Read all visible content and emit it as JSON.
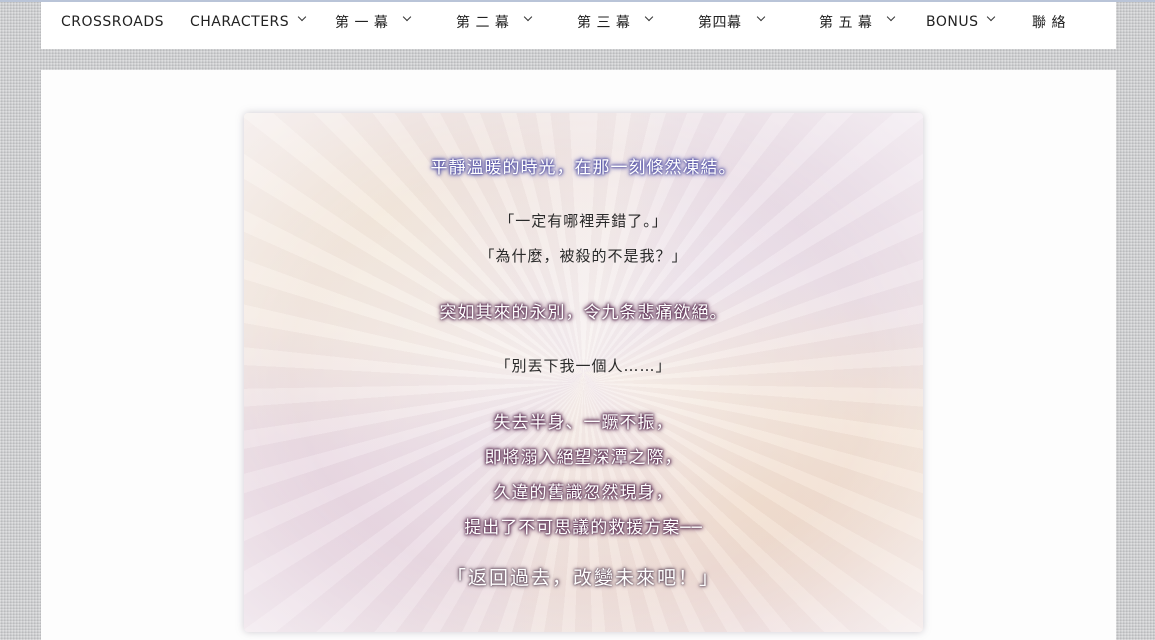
{
  "nav": {
    "items": [
      {
        "label": "CROSSROADS",
        "has_dropdown": false
      },
      {
        "label": "CHARACTERS",
        "has_dropdown": true
      },
      {
        "label": "第 一 幕",
        "has_dropdown": true
      },
      {
        "label": "第 二 幕",
        "has_dropdown": true
      },
      {
        "label": "第 三 幕",
        "has_dropdown": true
      },
      {
        "label": "第四幕",
        "has_dropdown": true
      },
      {
        "label": "第 五 幕",
        "has_dropdown": true
      },
      {
        "label": "BONUS",
        "has_dropdown": true
      },
      {
        "label": "聯 絡",
        "has_dropdown": false
      }
    ]
  },
  "story": {
    "lines": [
      {
        "text": "平靜溫暖的時光，在那一刻倏然凍結。",
        "style": "glow-blue"
      },
      {
        "text": "「一定有哪裡弄錯了。」",
        "style": "quote"
      },
      {
        "text": "「為什麼，被殺的不是我？」",
        "style": "quote"
      },
      {
        "text": "突如其來的永別，令九条悲痛欲絕。",
        "style": "glow-purple"
      },
      {
        "text": "「別丟下我一個人……」",
        "style": "quote"
      },
      {
        "text": "失去半身、一蹶不振，",
        "style": "glow-purple"
      },
      {
        "text": "即將溺入絕望深潭之際，",
        "style": "glow-purple"
      },
      {
        "text": "久違的舊識忽然現身，",
        "style": "glow-purple"
      },
      {
        "text": "提出了不可思議的救援方案──",
        "style": "glow-purple"
      },
      {
        "text": "「返回過去，改變未來吧！」",
        "style": "big"
      }
    ]
  },
  "colors": {
    "page_bg": "#cfd0d2",
    "nav_bg": "#ffffff",
    "content_bg": "#fdfdfd",
    "glow_blue": "#5a58a8",
    "glow_purple": "#5b2f52"
  }
}
